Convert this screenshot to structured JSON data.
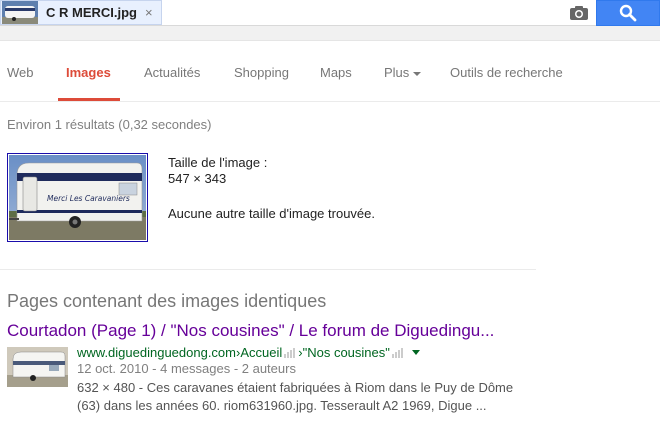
{
  "search": {
    "chip_label": "C R MERCI.jpg",
    "chip_close": "×"
  },
  "nav": {
    "tabs": [
      {
        "label": "Web"
      },
      {
        "label": "Images"
      },
      {
        "label": "Actualités"
      },
      {
        "label": "Shopping"
      },
      {
        "label": "Maps"
      },
      {
        "label": "Plus"
      },
      {
        "label": "Outils de recherche"
      }
    ],
    "active_tab": "Images"
  },
  "stats": "Environ 1 résultats (0,32 secondes)",
  "image_info": {
    "size_label": "Taille de l'image :",
    "size_value": "547 × 343",
    "no_other": "Aucune autre taille d'image trouvée.",
    "caravan_text": "Merci Les Caravaniers"
  },
  "identical": {
    "section_title": "Pages contenant des images identiques",
    "results": [
      {
        "title": "Courtadon (Page 1) / \"Nos cousines\" / Le forum de Diguedingu...",
        "url_domain": "www.diguedinguedong.com",
        "url_sep1": " › ",
        "url_part1": "Accueil",
        "url_sep2": " › ",
        "url_part2": "\"Nos cousines\"",
        "meta": "12 oct. 2010 - 4 messages - 2 auteurs",
        "snippet_line1": "632 × 480 - Ces caravanes étaient fabriquées à Riom dans le Puy de Dôme",
        "snippet_line2": "(63) dans les années 60. riom631960.jpg. Tesseraul​t A2 1969, Digue ..."
      }
    ]
  },
  "colors": {
    "accent": "#dd4b39",
    "search_button": "#4285f4",
    "link_visited": "#660099",
    "url_green": "#006621"
  }
}
